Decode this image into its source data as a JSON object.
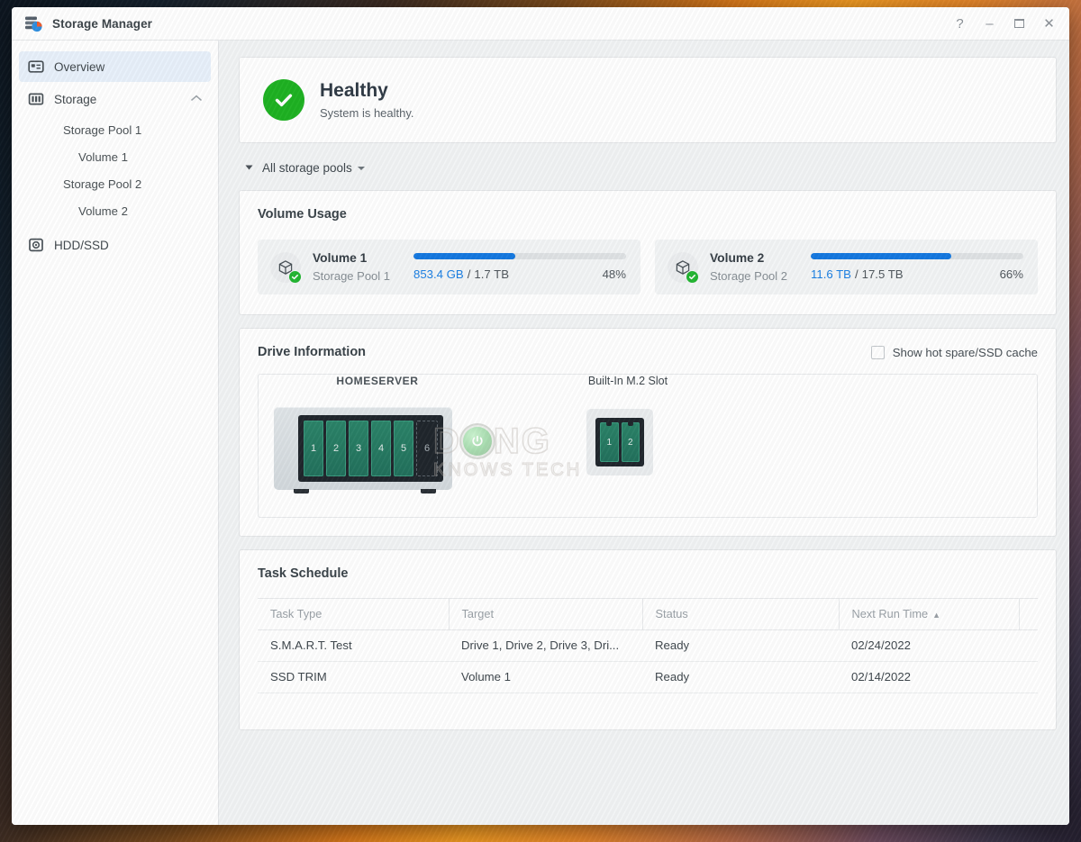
{
  "window": {
    "title": "Storage Manager",
    "icon": "storage-manager-icon",
    "controls": {
      "help": "?",
      "minimize": "–",
      "maximize": "maximize-icon",
      "close": "✕"
    }
  },
  "sidebar": {
    "items": [
      {
        "label": "Overview",
        "icon": "overview-icon",
        "selected": true
      },
      {
        "label": "Storage",
        "icon": "storage-icon",
        "expanded": true,
        "caret": "chevron-up-icon"
      },
      {
        "label": "Storage Pool 1",
        "level": 1
      },
      {
        "label": "Volume 1",
        "level": 2
      },
      {
        "label": "Storage Pool 2",
        "level": 1
      },
      {
        "label": "Volume 2",
        "level": 2
      },
      {
        "label": "HDD/SSD",
        "icon": "hdd-ssd-icon"
      }
    ]
  },
  "health": {
    "icon": "check-circle-icon",
    "title": "Healthy",
    "subtitle": "System is healthy.",
    "color": "#1eb222"
  },
  "pool_selector": {
    "label": "All storage pools",
    "left_caret": "triangle-down-icon",
    "right_caret": "caret-down-icon"
  },
  "volume_usage": {
    "title": "Volume Usage",
    "accent": "#1478e0",
    "volumes": [
      {
        "name": "Volume 1",
        "pool": "Storage Pool 1",
        "used": "853.4 GB",
        "separator": "/",
        "total": "1.7 TB",
        "percent_label": "48%",
        "percent": 48,
        "icon": "volume-cube-icon",
        "status_icon": "check-badge-icon"
      },
      {
        "name": "Volume 2",
        "pool": "Storage Pool 2",
        "used": "11.6 TB",
        "separator": "/",
        "total": "17.5 TB",
        "percent_label": "66%",
        "percent": 66,
        "icon": "volume-cube-icon",
        "status_icon": "check-badge-icon"
      }
    ]
  },
  "drive_information": {
    "title": "Drive Information",
    "hot_spare_label": "Show hot spare/SSD cache",
    "hot_spare_checked": false,
    "enclosures": [
      {
        "caption": "HOMESERVER",
        "type": "main",
        "bays": [
          {
            "number": "1",
            "state": "filled"
          },
          {
            "number": "2",
            "state": "filled"
          },
          {
            "number": "3",
            "state": "filled"
          },
          {
            "number": "4",
            "state": "filled"
          },
          {
            "number": "5",
            "state": "filled"
          },
          {
            "number": "6",
            "state": "empty"
          }
        ]
      },
      {
        "caption": "Built-In M.2 Slot",
        "type": "m2",
        "bays": [
          {
            "number": "1",
            "state": "filled"
          },
          {
            "number": "2",
            "state": "filled"
          }
        ]
      }
    ]
  },
  "task_schedule": {
    "title": "Task Schedule",
    "columns": [
      {
        "label": "Task Type",
        "sorted": false
      },
      {
        "label": "Target",
        "sorted": false
      },
      {
        "label": "Status",
        "sorted": false
      },
      {
        "label": "Next Run Time",
        "sorted": true,
        "sort_caret": "▲"
      },
      {
        "label": "",
        "sorted": false
      }
    ],
    "rows": [
      {
        "task_type": "S.M.A.R.T. Test",
        "target": "Drive 1, Drive 2, Drive 3, Dri...",
        "status": "Ready",
        "next_run_time": "02/24/2022",
        "extra": ""
      },
      {
        "task_type": "SSD TRIM",
        "target": "Volume 1",
        "status": "Ready",
        "next_run_time": "02/14/2022",
        "extra": ""
      }
    ]
  },
  "watermark": {
    "line1_a": "D",
    "line1_b": "NG",
    "line2": "KNOWS TECH",
    "icon": "power-button-icon"
  }
}
